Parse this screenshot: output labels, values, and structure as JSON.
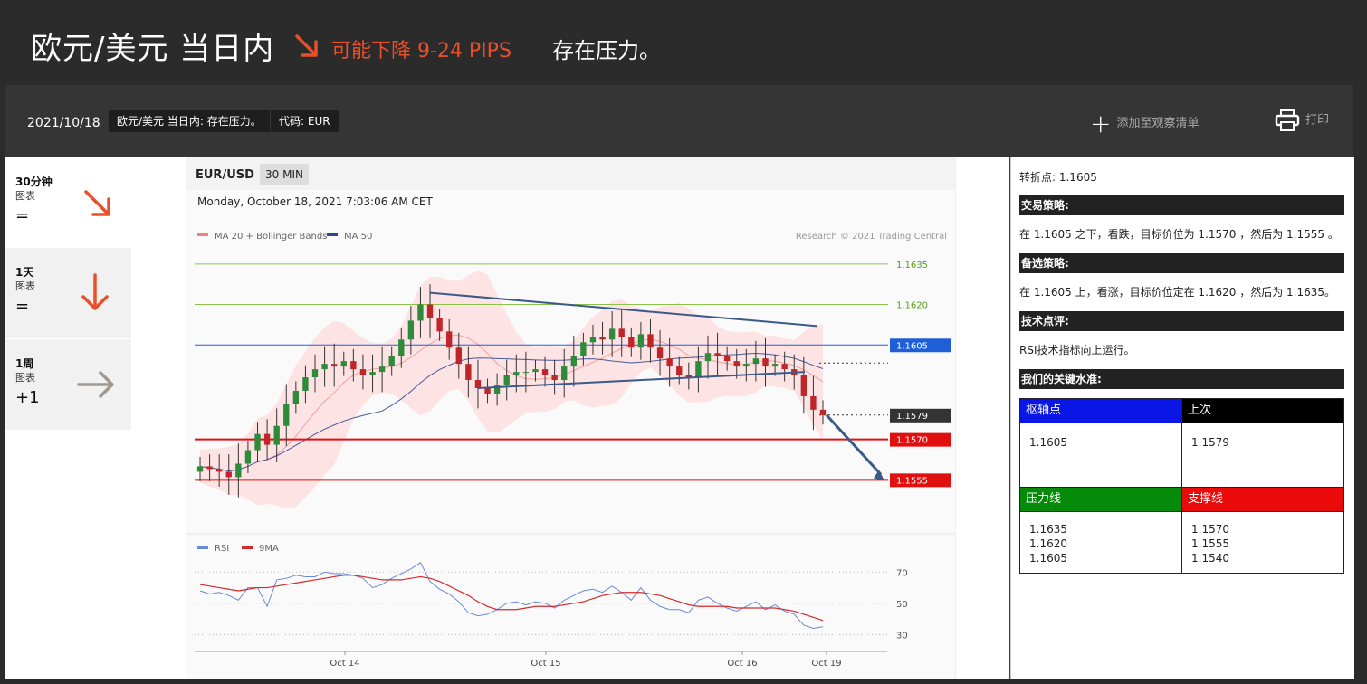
{
  "header": {
    "title": "欧元/美元 当日内",
    "forecast": "可能下降 9-24 PIPS",
    "pressure": "存在压力。"
  },
  "subheader": {
    "date": "2021/10/18",
    "tag_title": "欧元/美元 当日内: 存在压力。",
    "tag_code": "代码: EUR",
    "watchlist": "添加至观察清单",
    "print": "打印"
  },
  "timeframes": [
    {
      "name": "30分钟",
      "sub": "图表",
      "symbol": "=",
      "direction": "down-right",
      "color": "#e8502c"
    },
    {
      "name": "1天",
      "sub": "图表",
      "symbol": "=",
      "direction": "down",
      "color": "#e8502c"
    },
    {
      "name": "1周",
      "sub": "图表",
      "symbol": "+1",
      "direction": "right",
      "color": "#a09990"
    }
  ],
  "chart": {
    "pair": "EUR/USD",
    "timeframe": "30 MIN",
    "timestamp": "Monday, October 18, 2021 7:03:06 AM CET",
    "legend_ma20": "MA 20 + Bollinger Bands",
    "legend_ma50": "MA 50",
    "credit": "Research © 2021 Trading Central",
    "rsi_legend": "RSI",
    "rsi_ma_legend": "9MA",
    "x_labels": [
      "Oct 14",
      "Oct 15",
      "Oct 16",
      "Oct 19"
    ],
    "rsi_levels": [
      "70",
      "50",
      "30"
    ],
    "colors": {
      "bull": "#2e8b3a",
      "bear": "#c0252a",
      "band": "#fde3e3",
      "ma50": "#4a5a9a",
      "trend": "#3a5a8a",
      "rsi": "#6a8ad8",
      "rsi_ma": "#d42a2a"
    }
  },
  "chart_data": {
    "type": "candlestick",
    "ylim": [
      1.1535,
      1.1645
    ],
    "levels": [
      {
        "value": 1.1635,
        "label": "1.1635",
        "kind": "target-up",
        "color": "#8bc34a"
      },
      {
        "value": 1.162,
        "label": "1.1620",
        "kind": "target-up",
        "color": "#8bc34a"
      },
      {
        "value": 1.1605,
        "label": "1.1605",
        "kind": "pivot",
        "color": "#1e5fd8"
      },
      {
        "value": 1.1579,
        "label": "1.1579",
        "kind": "last",
        "color": "#333333"
      },
      {
        "value": 1.157,
        "label": "1.1570",
        "kind": "support",
        "color": "#e01010"
      },
      {
        "value": 1.1555,
        "label": "1.1555",
        "kind": "support",
        "color": "#e01010"
      }
    ],
    "close": [
      1.156,
      1.1559,
      1.1558,
      1.1556,
      1.1561,
      1.1566,
      1.1572,
      1.1568,
      1.1575,
      1.1583,
      1.1588,
      1.1593,
      1.1596,
      1.1598,
      1.1597,
      1.1599,
      1.1596,
      1.1594,
      1.1595,
      1.1597,
      1.1601,
      1.1607,
      1.1614,
      1.162,
      1.1615,
      1.161,
      1.1604,
      1.1598,
      1.1592,
      1.1589,
      1.1587,
      1.159,
      1.1594,
      1.1595,
      1.1595,
      1.1596,
      1.1594,
      1.1592,
      1.1597,
      1.1601,
      1.1606,
      1.1608,
      1.1607,
      1.1611,
      1.1608,
      1.1604,
      1.1609,
      1.1604,
      1.16,
      1.1597,
      1.1594,
      1.1593,
      1.1599,
      1.1602,
      1.1601,
      1.1599,
      1.1597,
      1.1598,
      1.16,
      1.1597,
      1.1598,
      1.1596,
      1.1594,
      1.1586,
      1.1581,
      1.1579
    ],
    "rsi": [
      58,
      56,
      57,
      55,
      52,
      60,
      60,
      48,
      65,
      66,
      68,
      67,
      67,
      70,
      69,
      69,
      68,
      66,
      60,
      62,
      66,
      69,
      72,
      76,
      64,
      59,
      56,
      51,
      44,
      42,
      43,
      46,
      50,
      51,
      49,
      51,
      50,
      47,
      52,
      55,
      58,
      59,
      57,
      61,
      57,
      52,
      60,
      52,
      48,
      46,
      46,
      44,
      52,
      54,
      50,
      47,
      45,
      48,
      51,
      46,
      49,
      45,
      43,
      36,
      34,
      35
    ],
    "rsi_ma": [
      62,
      61,
      60,
      59,
      58,
      59,
      60,
      60,
      61,
      62,
      63,
      64,
      65,
      66,
      67,
      68,
      68,
      67,
      66,
      65,
      65,
      65,
      66,
      67,
      66,
      64,
      61,
      58,
      55,
      51,
      48,
      46,
      46,
      46,
      47,
      48,
      48,
      48,
      49,
      50,
      51,
      53,
      55,
      56,
      57,
      57,
      57,
      56,
      55,
      53,
      51,
      49,
      48,
      48,
      48,
      48,
      47,
      47,
      47,
      47,
      47,
      46,
      45,
      43,
      41,
      39
    ],
    "rsi_ylim": [
      25,
      80
    ],
    "x_labels": [
      "Oct 14",
      "Oct 15",
      "Oct 16",
      "Oct 19"
    ]
  },
  "right": {
    "pivot_text": "转折点: 1.1605",
    "strategy_head": "交易策略:",
    "strategy_text": "在 1.1605 之下，看跌，目标价位为 1.1570 ，然后为 1.1555 。",
    "alt_head": "备选策略:",
    "alt_text": "在 1.1605 上，看涨，目标价位定在 1.1620 ，然后为 1.1635。",
    "comment_head": "技术点评:",
    "comment_text": "RSI技术指标向上运行。",
    "levels_head": "我们的关键水准:",
    "pivot_label": "枢轴点",
    "last_label": "上次",
    "pivot_value": "1.1605",
    "last_value": "1.1579",
    "resistance_label": "压力线",
    "support_label": "支撑线",
    "resistance_values": [
      "1.1635",
      "1.1620",
      "1.1605"
    ],
    "support_values": [
      "1.1570",
      "1.1555",
      "1.1540"
    ],
    "pivot_color": "#0a16e6",
    "last_color": "#000000",
    "resistance_color": "#058a0a",
    "support_color": "#ea0a0a"
  }
}
